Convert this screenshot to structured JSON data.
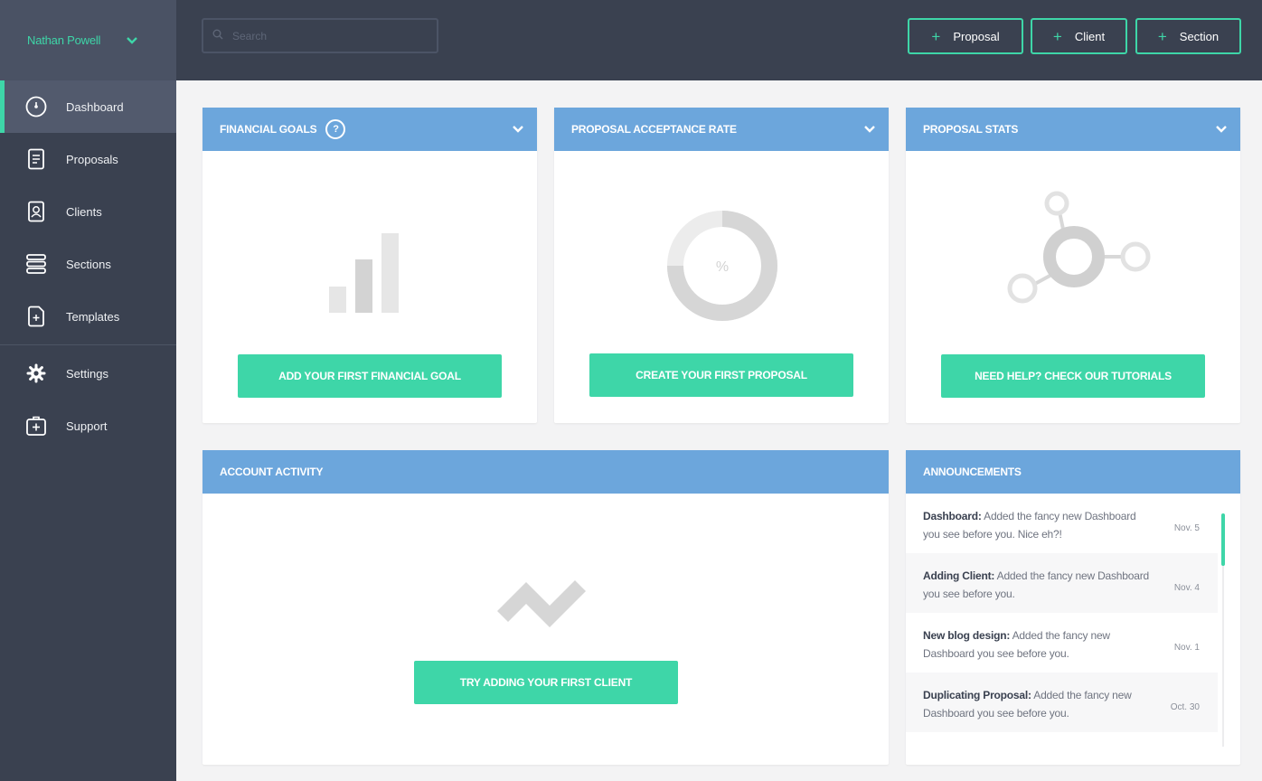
{
  "colors": {
    "sidebar": "#3a4150",
    "accent": "#3ed6a8",
    "card_header": "#6ca6dc",
    "placeholder_gray": "#dcdcdc"
  },
  "user": {
    "name": "Nathan Powell"
  },
  "nav": {
    "items": [
      {
        "label": "Dashboard",
        "icon": "dashboard-icon"
      },
      {
        "label": "Proposals",
        "icon": "document-icon"
      },
      {
        "label": "Clients",
        "icon": "contact-card-icon"
      },
      {
        "label": "Sections",
        "icon": "stack-icon"
      },
      {
        "label": "Templates",
        "icon": "template-file-icon"
      },
      {
        "label": "Settings",
        "icon": "gear-icon"
      },
      {
        "label": "Support",
        "icon": "first-aid-icon"
      }
    ]
  },
  "search": {
    "placeholder": "Search"
  },
  "toolbar": {
    "proposal_label": "Proposal",
    "client_label": "Client",
    "section_label": "Section",
    "plus": "+"
  },
  "financial_goals": {
    "title": "FINANCIAL GOALS",
    "help": "?",
    "cta": "ADD YOUR FIRST FINANCIAL GOAL",
    "percent_glyph": ""
  },
  "acceptance_rate": {
    "title": "PROPOSAL ACCEPTANCE RATE",
    "cta": "CREATE YOUR FIRST PROPOSAL",
    "percent_glyph": "%"
  },
  "proposal_stats": {
    "title": "PROPOSAL STATS",
    "cta": "NEED HELP? CHECK OUR TUTORIALS"
  },
  "account_activity": {
    "title": "ACCOUNT ACTIVITY",
    "cta": "TRY ADDING YOUR FIRST CLIENT"
  },
  "announcements": {
    "title": "ANNOUNCEMENTS",
    "items": [
      {
        "head": "Dashboard:",
        "body": " Added the fancy new Dashboard you see before you. Nice eh?!",
        "date": "Nov. 5"
      },
      {
        "head": "Adding Client:",
        "body": " Added the fancy new Dashboard you see before you.",
        "date": "Nov. 4"
      },
      {
        "head": "New blog design:",
        "body": " Added the fancy new Dashboard you see before you.",
        "date": "Nov. 1"
      },
      {
        "head": "Duplicating Proposal:",
        "body": " Added the fancy new Dashboard you see before you.",
        "date": "Oct. 30"
      }
    ]
  }
}
